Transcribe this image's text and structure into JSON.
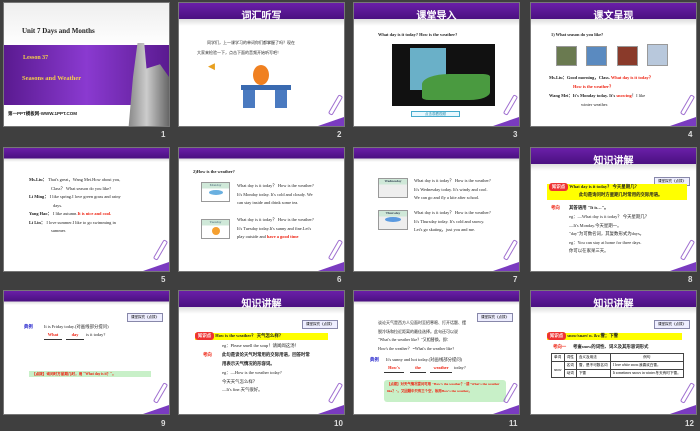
{
  "slides": [
    {
      "num": "1",
      "title": "Unit 7 Days and Months",
      "lesson": "Lesson 37",
      "subtitle": "Seasons and Weather",
      "footer": "第一PPT模板网-WWW.1PPT.COM"
    },
    {
      "num": "2",
      "title": "词汇听写",
      "text": [
        "同学们，上一课学习的单词你们都掌握了吗？现在",
        "大家来检验一下，点击下面的音频开始听写吧！"
      ]
    },
    {
      "num": "3",
      "title": "课堂导入",
      "question": "What day is it today? How is the weather?",
      "button": "点击观看视频"
    },
    {
      "num": "4",
      "title": "课文呈现",
      "q": "1)  What season do you like?",
      "l1a": "Ms.Liu：Good morning，Class. ",
      "l1b": "What day is it today？",
      "l2": "How is the weather？",
      "l3a": "Wang Mei：It's Monday today. It's ",
      "l3b": "snowing",
      "l3c": "！I like",
      "l4": "winter weather."
    },
    {
      "num": "5",
      "lines": [
        [
          "Ms.Liu：",
          "That's great，Wang Mei.How about you,"
        ],
        [
          "",
          "Class？ What season do you like?"
        ],
        [
          "Li Ming：",
          "I like spring.I love green grass and rainy"
        ],
        [
          "",
          "days."
        ],
        [
          "Yang Hao：",
          "I like autumn."
        ],
        [
          "Li Lin：",
          "I love summer.I like to go swimming in"
        ],
        [
          "",
          "summer."
        ]
      ],
      "red": "It is nice and cool."
    },
    {
      "num": "6",
      "q": "2)How is the weather?",
      "d1": "Monday",
      "p1": [
        "What day is it today？ How is the weather?",
        "It's Monday today. It's cold and cloudy. We",
        "can stay inside and drink some tea."
      ],
      "d2": "Tuesday",
      "p2": [
        "What day is it today？ How is the weather?",
        "It's Tuesday today.It's sunny and fine.Let's",
        "play outside and "
      ],
      "red": "have a good time"
    },
    {
      "num": "7",
      "d1": "Wednesday",
      "p1": [
        "What day is it today？ How is the weather?",
        "It's Wednesday today. It's windy and cool.",
        "We can go and fly  a kite after  school."
      ],
      "d2": "Thursday",
      "p2": [
        "What day is it today？ How is the weather?",
        "It's Thursday today. It's cold and snowy.",
        "Let's go skating，just you and me."
      ]
    },
    {
      "num": "8",
      "title": "知识讲解",
      "tag": "课堂探究《点拨》",
      "kp": "知识点",
      "q": "What day is it today？ 今天星期几？",
      "q2": "此句是询问时方星期几时常用的交际用语。",
      "kaoxiang": "考向",
      "ans": "其答语用 \"It is…\"。",
      "lines": [
        "eg：—What day is it today？ 今天星期几？",
        "      —It's Monday.今天星期一。",
        "\"day\"为可数名词，其复数形式为days。",
        "eg：You can stay at home for  three days.",
        "       你可以在家呆三天。"
      ]
    },
    {
      "num": "9",
      "tag": "课堂探究《点拨》",
      "dianli": "典例",
      "line1": "It is Friday today.(对画线部分提问)",
      "a1": "What",
      "a2": "day",
      "line2": "is it today?",
      "note": "【点拨】询问时方星期几时，用 \"What day is it？\"。"
    },
    {
      "num": "10",
      "title": "知识讲解",
      "tag": "课堂探究《点拨》",
      "kp": "知识点",
      "q": "How is the weather？ 天气怎么样？",
      "eg": "eg：Please smell the soup！请闻闻这汤！",
      "kaoxiang": "考向",
      "k1": "此句是谈论天气时常用的交际用语，回答时常",
      "k2": "用表示天气情况的形容词。",
      "lines": [
        "eg：—How is the weather today?",
        "        今天天气怎么样？",
        "      —It's fine.天气很好。"
      ]
    },
    {
      "num": "11",
      "tag": "课堂探究《点拨》",
      "lines": [
        "谈论天气是西方人见面时至招寒暄、打开话题、摆",
        "脱冷场和拉近距离的最佳选择。此句还可以说",
        "\"What's the weather like？\"又相替换，即：",
        "How's the weather？ =What's the weather like?"
      ],
      "dianli": "典例",
      "l5": "It's sunny and hot today.(对画线部分提问)",
      "a": [
        "How's",
        "the",
        "weather"
      ],
      "l6": "today?",
      "note": "【点拨】对天气情况提问可用 \"How's the weather？\"或\"What's the weather like？\"。又因题中只有三个空，故用How's the weather。"
    },
    {
      "num": "12",
      "title": "知识讲解",
      "tag": "课堂探究《点拨》",
      "kp": "知识点",
      "q": "snow/snəʊ/ n. &v.雪；下雪",
      "kaoxiang": "考向一",
      "k": "考查snow的词性、词义及其形容词形式",
      "table": {
        "headers": [
          "单词",
          "词性",
          "含义及用法",
          "例句"
        ],
        "word": "snow",
        "rows": [
          [
            "名词",
            "雪，是不可数名词",
            "I love white snow.我喜欢白雪。"
          ],
          [
            "动词",
            "下雪",
            "It sometimes snows in winter.冬天有时下雪。"
          ]
        ]
      }
    }
  ]
}
